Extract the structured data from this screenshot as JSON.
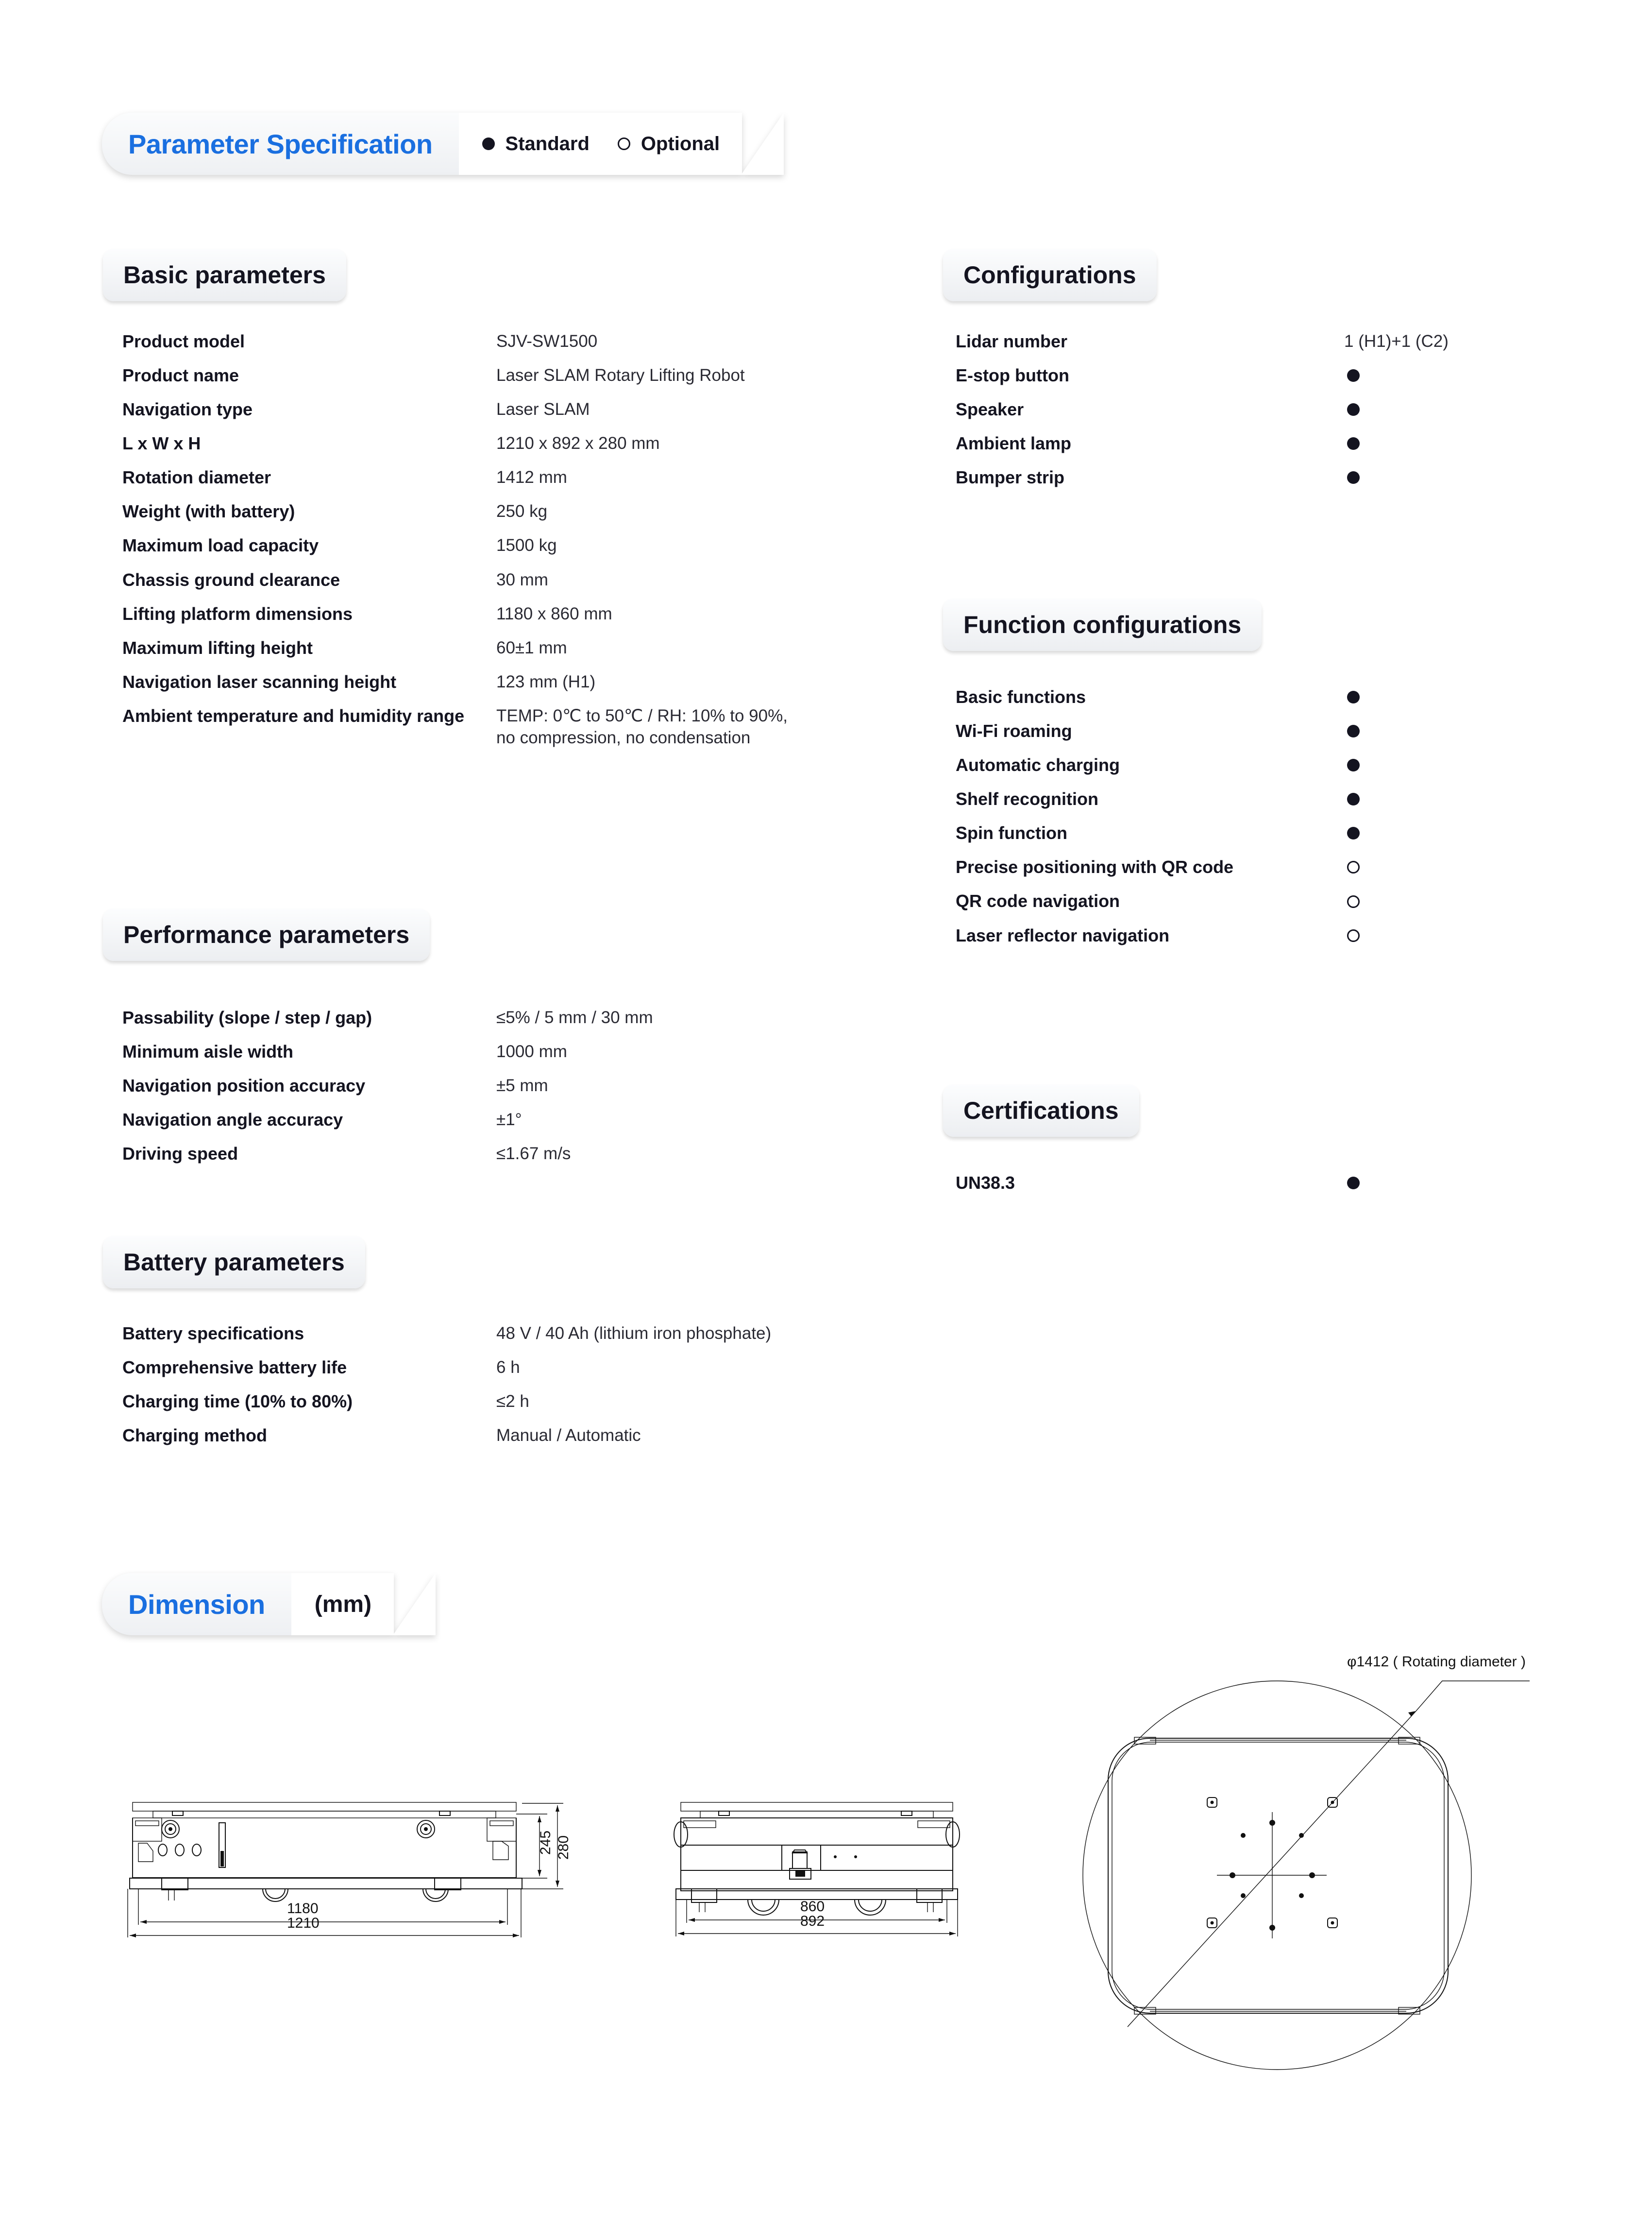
{
  "header": {
    "title": "Parameter Specification",
    "legend": [
      {
        "label": "Standard",
        "marker": "solid"
      },
      {
        "label": "Optional",
        "marker": "hollow"
      }
    ]
  },
  "sections": {
    "basic": {
      "title": "Basic parameters",
      "rows": [
        {
          "label": "Product model",
          "value": "SJV-SW1500"
        },
        {
          "label": "Product name",
          "value": "Laser SLAM Rotary Lifting Robot"
        },
        {
          "label": "Navigation type",
          "value": "Laser SLAM"
        },
        {
          "label": "L x W x H",
          "value": "1210 x 892 x 280 mm"
        },
        {
          "label": "Rotation diameter",
          "value": "1412 mm"
        },
        {
          "label": "Weight (with battery)",
          "value": "250 kg"
        },
        {
          "label": "Maximum load capacity",
          "value": "1500 kg"
        },
        {
          "label": "Chassis ground clearance",
          "value": "30 mm"
        },
        {
          "label": "Lifting platform dimensions",
          "value": "1180 x 860 mm"
        },
        {
          "label": "Maximum lifting height",
          "value": "60±1 mm"
        },
        {
          "label": "Navigation laser scanning height",
          "value": "123 mm (H1)"
        },
        {
          "label": "Ambient temperature and\nhumidity range",
          "value": "TEMP: 0℃ to 50℃ / RH: 10% to 90%,\nno compression, no condensation"
        }
      ]
    },
    "performance": {
      "title": "Performance parameters",
      "rows": [
        {
          "label": "Passability (slope / step / gap)",
          "value": "≤5% / 5 mm / 30 mm"
        },
        {
          "label": "Minimum aisle width",
          "value": "1000 mm"
        },
        {
          "label": "Navigation position accuracy",
          "value": "±5 mm"
        },
        {
          "label": "Navigation angle accuracy",
          "value": "±1°"
        },
        {
          "label": "Driving speed",
          "value": "≤1.67 m/s"
        }
      ]
    },
    "battery": {
      "title": "Battery parameters",
      "rows": [
        {
          "label": "Battery specifications",
          "value": "48 V / 40 Ah (lithium iron phosphate)"
        },
        {
          "label": "Comprehensive battery life",
          "value": "6 h"
        },
        {
          "label": "Charging time (10% to 80%)",
          "value": "≤2 h"
        },
        {
          "label": "Charging method",
          "value": "Manual / Automatic"
        }
      ]
    },
    "configurations": {
      "title": "Configurations",
      "rows": [
        {
          "label": "Lidar number",
          "value": "1 (H1)+1 (C2)",
          "marker": "text"
        },
        {
          "label": "E-stop button",
          "value": "",
          "marker": "solid"
        },
        {
          "label": "Speaker",
          "value": "",
          "marker": "solid"
        },
        {
          "label": "Ambient lamp",
          "value": "",
          "marker": "solid"
        },
        {
          "label": "Bumper strip",
          "value": "",
          "marker": "solid"
        }
      ]
    },
    "functions": {
      "title": "Function configurations",
      "rows": [
        {
          "label": "Basic functions",
          "value": "",
          "marker": "solid"
        },
        {
          "label": "Wi-Fi roaming",
          "value": "",
          "marker": "solid"
        },
        {
          "label": "Automatic charging",
          "value": "",
          "marker": "solid"
        },
        {
          "label": "Shelf recognition",
          "value": "",
          "marker": "solid"
        },
        {
          "label": "Spin function",
          "value": "",
          "marker": "solid"
        },
        {
          "label": "Precise positioning with QR code",
          "value": "",
          "marker": "hollow"
        },
        {
          "label": "QR code navigation",
          "value": "",
          "marker": "hollow"
        },
        {
          "label": "Laser reflector navigation",
          "value": "",
          "marker": "hollow"
        }
      ]
    },
    "certifications": {
      "title": "Certifications",
      "rows": [
        {
          "label": "UN38.3",
          "value": "",
          "marker": "solid"
        }
      ]
    }
  },
  "dimension": {
    "title": "Dimension",
    "unit": "(mm)",
    "side_view": {
      "length_outer": "1210",
      "length_inner": "1180",
      "height_outer": "280",
      "height_inner": "245"
    },
    "front_view": {
      "width_outer": "892",
      "width_inner": "860"
    },
    "top_view": {
      "rotating_diameter": "φ1412 ( Rotating diameter )"
    }
  },
  "colors": {
    "accent": "#1a6fe0",
    "text": "#141420",
    "value_text": "#2a2a33",
    "pill_bg_top": "#fcfdfe",
    "pill_bg_bottom": "#eceef1"
  }
}
